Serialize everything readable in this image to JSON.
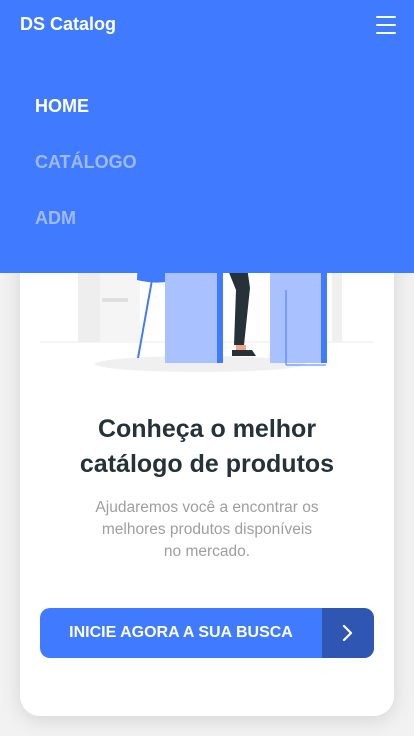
{
  "header": {
    "brand": "DS Catalog",
    "menu_icon": "hamburger-menu-icon",
    "background_color": "#407bff"
  },
  "nav": {
    "items": [
      {
        "label": "HOME",
        "active": true
      },
      {
        "label": "CATÁLOGO",
        "active": false
      },
      {
        "label": "ADM",
        "active": false
      }
    ]
  },
  "hero": {
    "illustration": "person-at-desk-illustration",
    "title_line1": "Conheça o melhor",
    "title_line2": "catálogo de produtos",
    "subtitle_line1": "Ajudaremos você a encontrar os",
    "subtitle_line2": "melhores produtos disponíveis",
    "subtitle_line3": "no mercado.",
    "cta_label": "INICIE AGORA A SUA BUSCA",
    "cta_icon": "chevron-right-icon",
    "accent_color": "#407bff",
    "cta_arrow_bg": "#2f56b3"
  }
}
